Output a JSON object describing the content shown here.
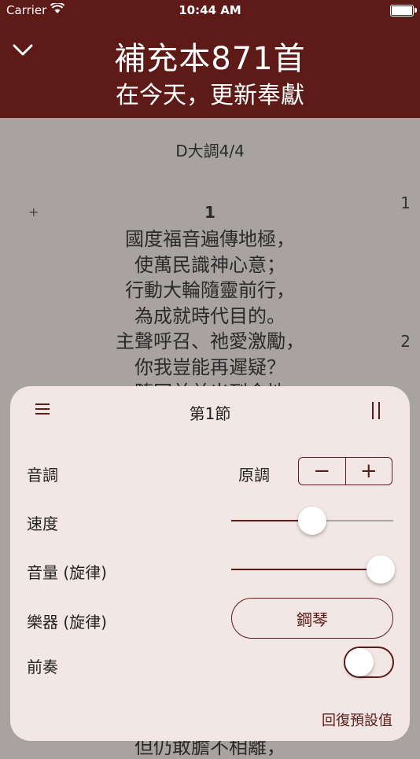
{
  "status_bar": {
    "carrier": "Carrier",
    "time": "10:44 AM"
  },
  "header": {
    "title": "補充本871首",
    "subtitle": "在今天，更新奉獻"
  },
  "song": {
    "key_signature": "D大調4/4",
    "expand_symbol": "+",
    "verse_number": "1",
    "margin_numbers": [
      "1",
      "2"
    ],
    "lyrics": [
      "國度福音遍傳地極，",
      "使萬民識神心意；",
      "行動大輪隨靈前行，",
      "為成就時代目的。",
      "主聲呼召、祂愛激勵，",
      "你我豈能再遲疑？",
      "隨同羊羊出到金地"
    ],
    "bottom_line": "但仍敢膽不相離，"
  },
  "panel": {
    "title": "第1節",
    "key_label": "音調",
    "key_value": "原調",
    "stepper_minus": "−",
    "stepper_plus": "+",
    "tempo_label": "速度",
    "tempo_value": 0.5,
    "volume_label": "音量 (旋律)",
    "volume_value": 0.92,
    "instrument_label": "樂器 (旋律)",
    "instrument_value": "鋼琴",
    "prelude_label": "前奏",
    "prelude_on": false,
    "reset_label": "回復預設值"
  }
}
